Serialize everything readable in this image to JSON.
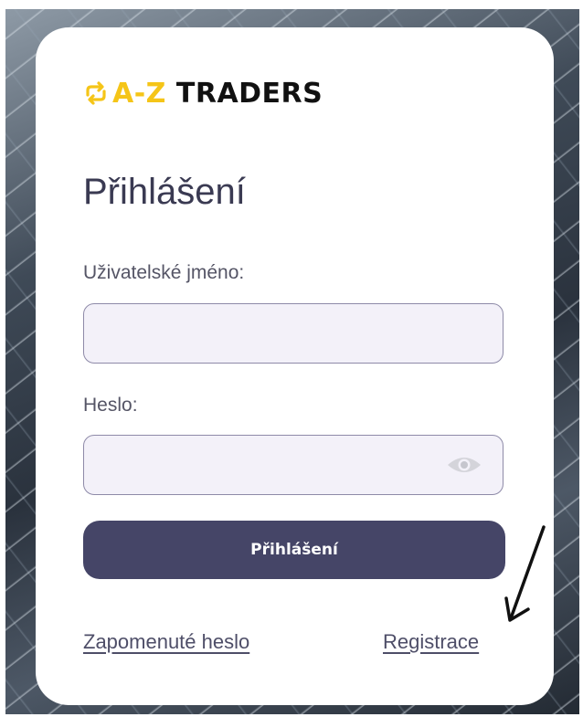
{
  "brand": {
    "mark": "A-Z",
    "name": "TRADERS",
    "accent_color": "#f5c518"
  },
  "login": {
    "title": "Přihlášení",
    "username_label": "Uživatelské jméno:",
    "username_value": "",
    "password_label": "Heslo:",
    "password_value": "",
    "show_password_icon": "eye-icon",
    "submit_label": "Přihlášení",
    "forgot_link": "Zapomenuté heslo",
    "register_link": "Registrace",
    "button_color": "#454567"
  }
}
